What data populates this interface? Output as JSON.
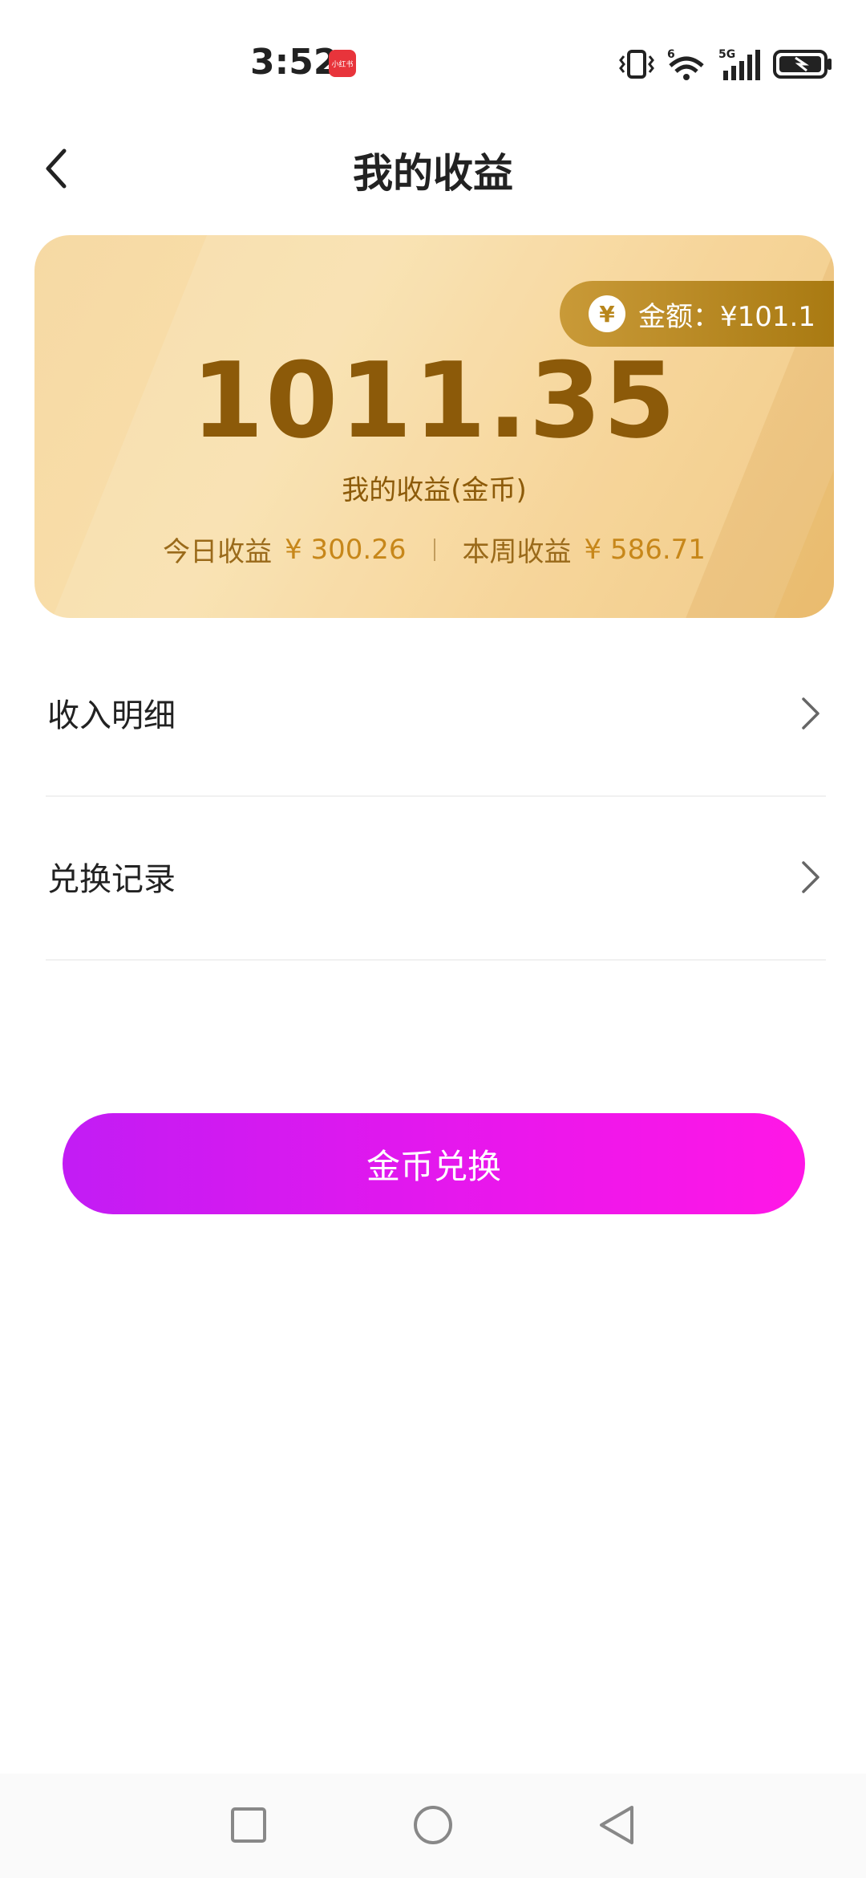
{
  "status_bar": {
    "time": "3:52",
    "app_badge": "小红书",
    "icons": [
      "vibrate-icon",
      "wifi-icon",
      "signal-5g-icon",
      "battery-charging-icon"
    ],
    "wifi_label": "6",
    "network_label": "5G"
  },
  "header": {
    "title": "我的收益",
    "back_icon": "chevron-left-icon"
  },
  "card": {
    "amount_pill": {
      "icon": "yuan-icon",
      "icon_text": "¥",
      "text": "金额：¥101.1"
    },
    "balance": "1011.35",
    "balance_caption": "我的收益(金币)",
    "today_label": "今日收益",
    "today_value": "¥ 300.26",
    "week_label": "本周收益",
    "week_value": "¥ 586.71"
  },
  "menu": {
    "items": [
      {
        "label": "收入明细",
        "icon": "chevron-right-icon"
      },
      {
        "label": "兑换记录",
        "icon": "chevron-right-icon"
      }
    ]
  },
  "actions": {
    "exchange_label": "金币兑换"
  },
  "colors": {
    "card_gold": "#f6d9a4",
    "balance_brown": "#8c5a09",
    "accent_gold": "#c7871a",
    "button_purple": "#c21cf4",
    "button_pink": "#ff17e6"
  },
  "nav_bar": {
    "buttons": [
      "recents-square-icon",
      "home-circle-icon",
      "back-triangle-icon"
    ]
  }
}
